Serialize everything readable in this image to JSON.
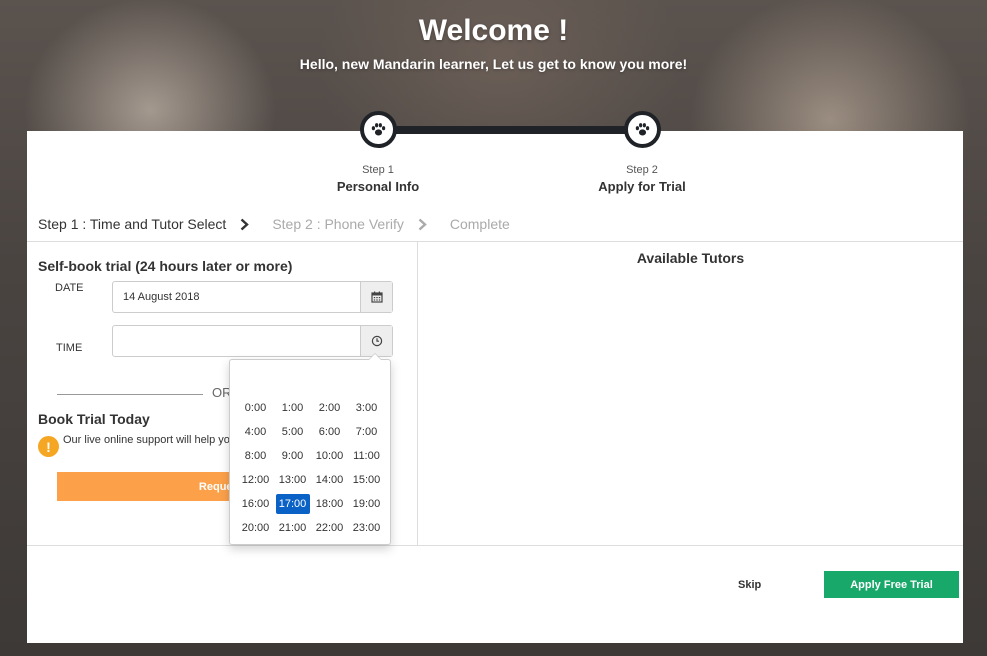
{
  "hero": {
    "title": "Welcome !",
    "subtitle": "Hello, new Mandarin learner, Let us get to know you more!"
  },
  "steps": [
    {
      "small": "Step 1",
      "label": "Personal Info",
      "icon": "paw-icon"
    },
    {
      "small": "Step 2",
      "label": "Apply for Trial",
      "icon": "paw-icon"
    }
  ],
  "breadcrumb": {
    "items": [
      "Step 1 : Time and Tutor Select",
      "Step 2 : Phone Verify",
      "Complete"
    ]
  },
  "self_book": {
    "title": "Self-book trial (24 hours later or more)",
    "date_label": "DATE",
    "date_value": "14 August 2018",
    "time_label": "TIME",
    "time_value": ""
  },
  "divider_or": "OR",
  "book_today": {
    "title": "Book Trial Today",
    "info_text": "Our live online support will help you",
    "request_label": "Request Trial"
  },
  "tutors": {
    "title": "Available Tutors"
  },
  "footer": {
    "skip_label": "Skip",
    "apply_label": "Apply Free Trial"
  },
  "time_picker": {
    "selected": "17:00",
    "options": [
      "0:00",
      "1:00",
      "2:00",
      "3:00",
      "4:00",
      "5:00",
      "6:00",
      "7:00",
      "8:00",
      "9:00",
      "10:00",
      "11:00",
      "12:00",
      "13:00",
      "14:00",
      "15:00",
      "16:00",
      "17:00",
      "18:00",
      "19:00",
      "20:00",
      "21:00",
      "22:00",
      "23:00"
    ]
  },
  "colors": {
    "primary_button": "#18a86a",
    "request_button": "#fca14a",
    "selected_time": "#0a62c6",
    "info_icon": "#f5a623",
    "step_dark": "#1f2328"
  }
}
